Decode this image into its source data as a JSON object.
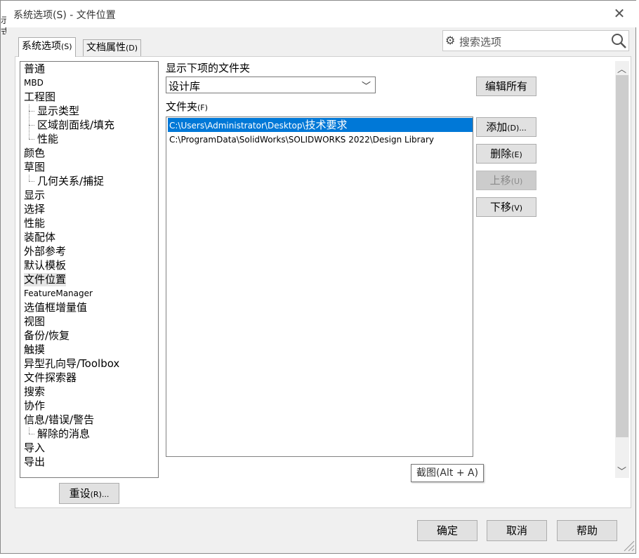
{
  "window": {
    "title": "系统选项(S) - 文件位置",
    "close_icon": "close-icon",
    "left_edge_text": "示\n式"
  },
  "tabs": [
    {
      "label": "系统选项",
      "accel": "(S)",
      "active": true
    },
    {
      "label": "文档属性",
      "accel": "(D)",
      "active": false
    }
  ],
  "search": {
    "placeholder": "搜索选项",
    "gear_icon": "gear-icon",
    "search_icon": "magnifier-icon"
  },
  "tree": {
    "items": [
      {
        "label": "普通",
        "level": 0
      },
      {
        "label": "MBD",
        "level": 0
      },
      {
        "label": "工程图",
        "level": 0
      },
      {
        "label": "显示类型",
        "level": 1
      },
      {
        "label": "区域剖面线/填充",
        "level": 1
      },
      {
        "label": "性能",
        "level": 1
      },
      {
        "label": "颜色",
        "level": 0
      },
      {
        "label": "草图",
        "level": 0
      },
      {
        "label": "几何关系/捕捉",
        "level": 1
      },
      {
        "label": "显示",
        "level": 0
      },
      {
        "label": "选择",
        "level": 0
      },
      {
        "label": "性能",
        "level": 0
      },
      {
        "label": "装配体",
        "level": 0
      },
      {
        "label": "外部参考",
        "level": 0
      },
      {
        "label": "默认模板",
        "level": 0
      },
      {
        "label": "文件位置",
        "level": 0,
        "selected": true
      },
      {
        "label": "FeatureManager",
        "level": 0
      },
      {
        "label": "选值框增量值",
        "level": 0
      },
      {
        "label": "视图",
        "level": 0
      },
      {
        "label": "备份/恢复",
        "level": 0
      },
      {
        "label": "触摸",
        "level": 0
      },
      {
        "label": "异型孔向导/Toolbox",
        "level": 0
      },
      {
        "label": "文件探索器",
        "level": 0
      },
      {
        "label": "搜索",
        "level": 0
      },
      {
        "label": "协作",
        "level": 0
      },
      {
        "label": "信息/错误/警告",
        "level": 0
      },
      {
        "label": "解除的消息",
        "level": 1
      },
      {
        "label": "导入",
        "level": 0
      },
      {
        "label": "导出",
        "level": 0
      }
    ]
  },
  "reset_button": {
    "label": "重设",
    "accel": "(R)..."
  },
  "main": {
    "show_folders_label": "显示下项的文件夹",
    "folder_type_value": "设计库",
    "folders_label": "文件夹",
    "folders_accel": "(F)",
    "folders": [
      {
        "path_prefix": "C:\\Users\\Administrator\\Desktop\\",
        "path_suffix": "技术要求",
        "selected": true
      },
      {
        "path_prefix": "C:\\ProgramData\\SolidWorks\\SOLIDWORKS 2022\\Design Library",
        "path_suffix": "",
        "selected": false
      }
    ]
  },
  "side_buttons": {
    "edit_all": {
      "label": "编辑所有"
    },
    "add": {
      "label": "添加",
      "accel": "(D)..."
    },
    "delete": {
      "label": "删除",
      "accel": "(E)"
    },
    "move_up": {
      "label": "上移",
      "accel": "(U)",
      "disabled": true
    },
    "move_down": {
      "label": "下移",
      "accel": "(V)"
    }
  },
  "tooltip": {
    "text": "截图(Alt + A)"
  },
  "footer": {
    "ok": "确定",
    "cancel": "取消",
    "help": "帮助"
  },
  "colors": {
    "selection": "#0078d7",
    "dialog_bg": "#f0f0f0",
    "button_bg": "#e1e1e1"
  }
}
